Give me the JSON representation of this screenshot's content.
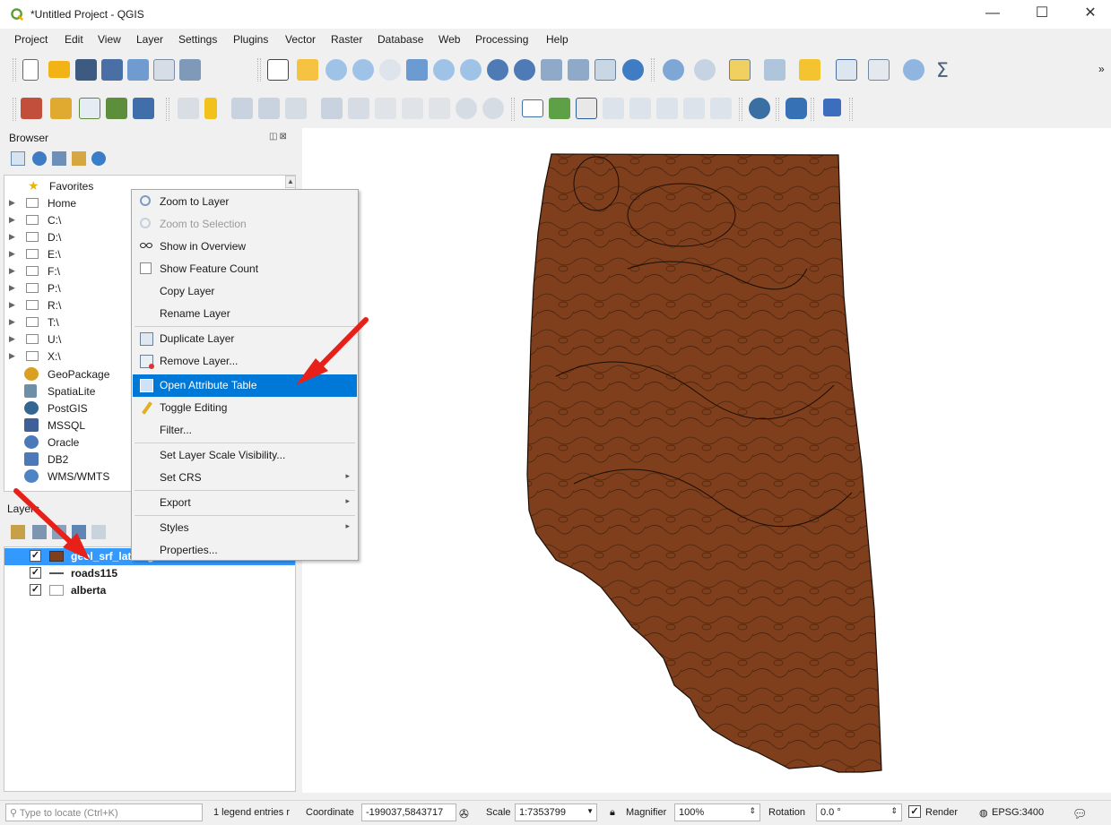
{
  "window": {
    "title": "*Untitled Project - QGIS",
    "minimize": "—",
    "maximize": "☐",
    "close": "✕"
  },
  "menubar": [
    "Project",
    "Edit",
    "View",
    "Layer",
    "Settings",
    "Plugins",
    "Vector",
    "Raster",
    "Database",
    "Web",
    "Processing",
    "Help"
  ],
  "toolbar_overflow": "»",
  "browser": {
    "title": "Browser",
    "panel_buttons": "◫⊠",
    "items": [
      {
        "label": "Favorites",
        "icon": "star-icon"
      },
      {
        "label": "Home",
        "icon": "home-icon"
      },
      {
        "label": "C:\\",
        "icon": "folder-icon"
      },
      {
        "label": "D:\\",
        "icon": "folder-icon"
      },
      {
        "label": "E:\\",
        "icon": "folder-icon"
      },
      {
        "label": "F:\\",
        "icon": "folder-icon"
      },
      {
        "label": "P:\\",
        "icon": "folder-icon"
      },
      {
        "label": "R:\\",
        "icon": "folder-icon"
      },
      {
        "label": "T:\\",
        "icon": "folder-icon"
      },
      {
        "label": "U:\\",
        "icon": "folder-icon"
      },
      {
        "label": "X:\\",
        "icon": "folder-icon"
      },
      {
        "label": "GeoPackage",
        "icon": "geopackage-icon"
      },
      {
        "label": "SpatiaLite",
        "icon": "spatialite-icon"
      },
      {
        "label": "PostGIS",
        "icon": "postgis-icon"
      },
      {
        "label": "MSSQL",
        "icon": "mssql-icon"
      },
      {
        "label": "Oracle",
        "icon": "oracle-icon"
      },
      {
        "label": "DB2",
        "icon": "db2-icon"
      },
      {
        "label": "WMS/WMTS",
        "icon": "wms-icon"
      }
    ]
  },
  "layers": {
    "title": "Layers",
    "items": [
      {
        "name": "geol_srf_latlong",
        "checked": "✓",
        "selected": true
      },
      {
        "name": "roads115",
        "checked": "✓",
        "selected": false
      },
      {
        "name": "alberta",
        "checked": "✓",
        "selected": false
      }
    ]
  },
  "context_menu": {
    "items": [
      {
        "label": "Zoom to Layer"
      },
      {
        "label": "Zoom to Selection"
      },
      {
        "label": "Show in Overview"
      },
      {
        "label": "Show Feature Count"
      },
      {
        "label": "Copy Layer"
      },
      {
        "label": "Rename Layer"
      },
      {
        "label": "Duplicate Layer"
      },
      {
        "label": "Remove Layer..."
      },
      {
        "label": "Open Attribute Table"
      },
      {
        "label": "Toggle Editing"
      },
      {
        "label": "Filter..."
      },
      {
        "label": "Set Layer Scale Visibility..."
      },
      {
        "label": "Set CRS"
      },
      {
        "label": "Export"
      },
      {
        "label": "Styles"
      },
      {
        "label": "Properties..."
      }
    ],
    "submenu_arrow": "▸"
  },
  "map": {
    "fill_color": "#7f3f1c",
    "stroke_color": "#1a0d05"
  },
  "statusbar": {
    "locator_placeholder": "Type to locate (Ctrl+K)",
    "legend_info": "1 legend entries r",
    "coordinate_label": "Coordinate",
    "coordinate_value": "-199037,5843717",
    "scale_label": "Scale",
    "scale_value": "1:7353799",
    "magnifier_label": "Magnifier",
    "magnifier_value": "100%",
    "rotation_label": "Rotation",
    "rotation_value": "0.0 °",
    "render_label": "Render",
    "render_checked": "✓",
    "crs_value": "EPSG:3400"
  },
  "colors": {
    "highlight": "#0078d7",
    "layer_selected": "#3399ff",
    "annotation_arrow": "#e8201a"
  }
}
